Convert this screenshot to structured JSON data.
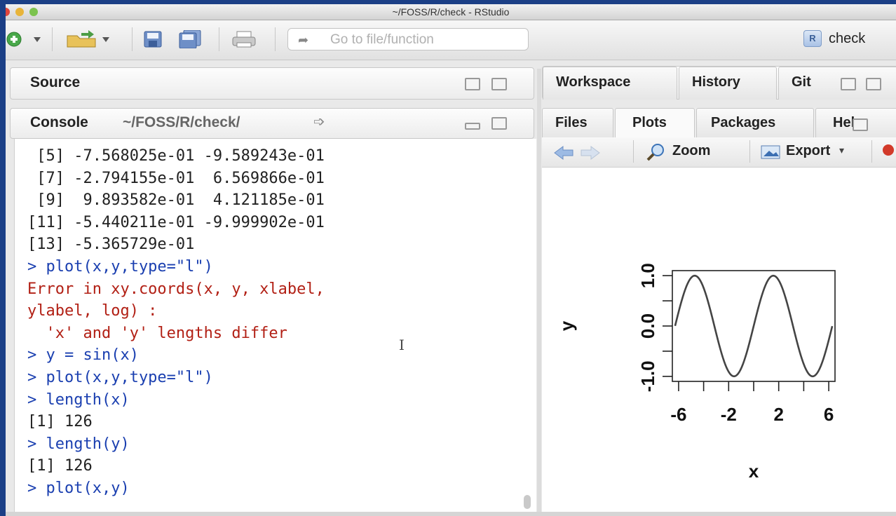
{
  "window": {
    "title": "~/FOSS/R/check - RStudio"
  },
  "toolbar": {
    "goto_placeholder": "Go to file/function",
    "project_label": "check"
  },
  "source_pane": {
    "title": "Source"
  },
  "console_pane": {
    "title": "Console",
    "path": "~/FOSS/R/check/"
  },
  "console_lines": [
    {
      "text": " [5] -7.568025e-01 -9.589243e-01",
      "kind": "out"
    },
    {
      "text": " [7] -2.794155e-01  6.569866e-01",
      "kind": "out"
    },
    {
      "text": " [9]  9.893582e-01  4.121185e-01",
      "kind": "out"
    },
    {
      "text": "[11] -5.440211e-01 -9.999902e-01",
      "kind": "out"
    },
    {
      "text": "[13] -5.365729e-01",
      "kind": "out"
    },
    {
      "text": "> plot(x,y,type=\"l\")",
      "kind": "cmd"
    },
    {
      "text": "Error in xy.coords(x, y, xlabel,",
      "kind": "err"
    },
    {
      "text": "ylabel, log) :",
      "kind": "err"
    },
    {
      "text": "  'x' and 'y' lengths differ",
      "kind": "err"
    },
    {
      "text": "> y = sin(x)",
      "kind": "cmd"
    },
    {
      "text": "> plot(x,y,type=\"l\")",
      "kind": "cmd"
    },
    {
      "text": "> length(x)",
      "kind": "cmd"
    },
    {
      "text": "[1] 126",
      "kind": "out"
    },
    {
      "text": "> length(y)",
      "kind": "cmd"
    },
    {
      "text": "[1] 126",
      "kind": "out"
    },
    {
      "text": "> plot(x,y)",
      "kind": "cmd"
    }
  ],
  "top_right_tabs": [
    "Workspace",
    "History",
    "Git"
  ],
  "bottom_right_tabs": [
    "Files",
    "Plots",
    "Packages",
    "Help"
  ],
  "plot_toolbar": {
    "zoom": "Zoom",
    "export": "Export"
  },
  "chart_data": {
    "type": "line",
    "function": "sin(x)",
    "x_range": [
      -6.28,
      6.28
    ],
    "xlim": [
      -6.5,
      6.5
    ],
    "ylim": [
      -1.1,
      1.1
    ],
    "xlabel": "x",
    "ylabel": "y",
    "x_ticks": [
      -6,
      -4,
      -2,
      0,
      2,
      4,
      6
    ],
    "x_tick_labels": [
      "-6",
      "-2",
      "2",
      "6"
    ],
    "y_ticks": [
      -1.0,
      -0.5,
      0.0,
      0.5,
      1.0
    ],
    "y_tick_labels": [
      "-1.0",
      "0.0",
      "1.0"
    ],
    "line_color": "#444444"
  },
  "colors": {
    "command": "#1a3fb0",
    "error": "#b22015",
    "output": "#222222"
  }
}
